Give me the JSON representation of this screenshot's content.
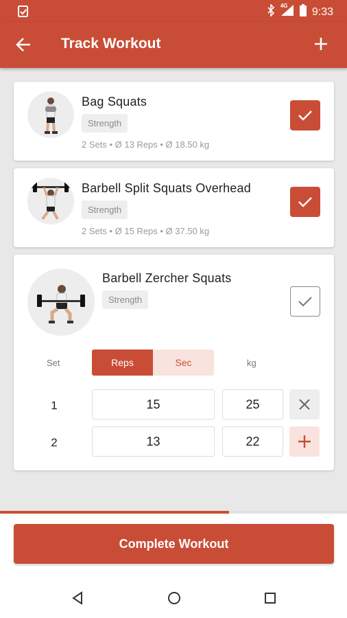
{
  "status_bar": {
    "time": "9:33",
    "network": "4G",
    "icons": [
      "app-clipboard-icon",
      "bluetooth-icon",
      "signal-icon",
      "battery-icon"
    ]
  },
  "app_bar": {
    "title": "Track Workout",
    "back_icon": "arrow-back-icon",
    "add_icon": "plus-icon"
  },
  "colors": {
    "primary": "#c94d36",
    "primary_light": "#f9e3df",
    "background": "#e8e8e8"
  },
  "exercises": [
    {
      "name": "Bag Squats",
      "category": "Strength",
      "stats": "2 Sets • Ø 13 Reps • Ø 18.50 kg",
      "completed": true
    },
    {
      "name": "Barbell Split Squats Overhead",
      "category": "Strength",
      "stats": "2 Sets • Ø 15 Reps • Ø 37.50 kg",
      "completed": true
    },
    {
      "name": "Barbell Zercher Squats",
      "category": "Strength",
      "completed": false,
      "table": {
        "set_header": "Set",
        "reps_tab": "Reps",
        "sec_tab": "Sec",
        "weight_header": "kg",
        "sets": [
          {
            "set": "1",
            "reps": "15",
            "kg": "25",
            "action_icon": "close-icon"
          },
          {
            "set": "2",
            "reps": "13",
            "kg": "22",
            "action_icon": "plus-icon"
          }
        ]
      }
    }
  ],
  "progress": 0.66,
  "complete_button": "Complete Workout",
  "nav": [
    "back-triangle-icon",
    "home-circle-icon",
    "recents-square-icon"
  ]
}
